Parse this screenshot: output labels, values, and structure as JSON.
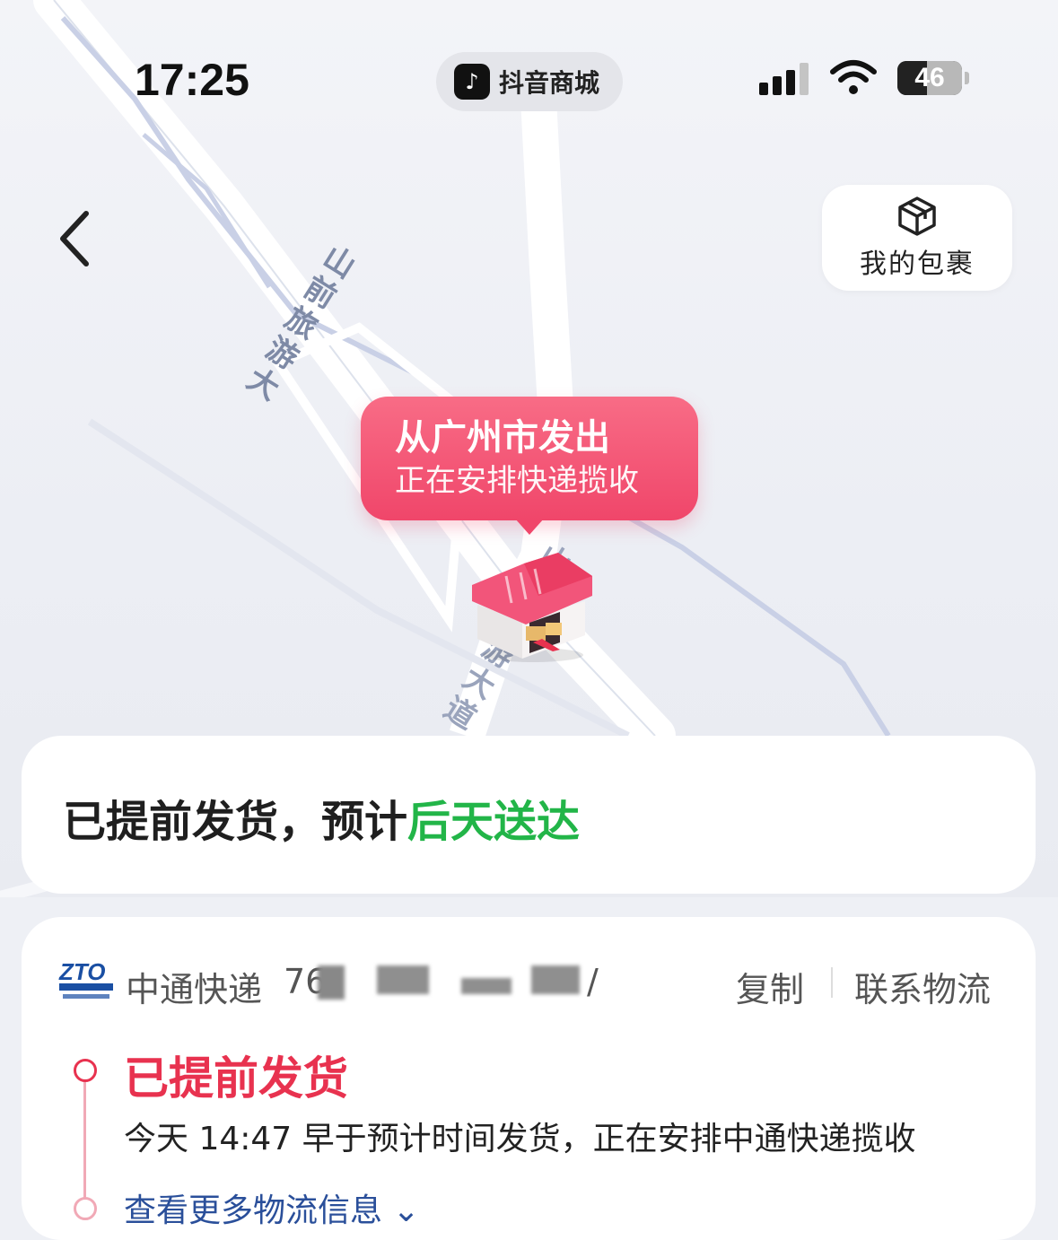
{
  "status_bar": {
    "time": "17:25",
    "app_name": "抖音商城",
    "battery_level": "46",
    "battery_fraction": 0.46
  },
  "map": {
    "road_label_upper": "山前旅游大",
    "road_label_lower": "山前旅游大道"
  },
  "header": {
    "parcel_label": "我的包裹"
  },
  "bubble": {
    "title": "从广州市发出",
    "subtitle": "正在安排快递揽收"
  },
  "eta": {
    "prefix": "已提前发货，预计",
    "highlight": "后天送达",
    "highlight_color": "#22b548"
  },
  "tracking": {
    "carrier_name": "中通快递",
    "tracking_number_visible": "76",
    "tracking_number_end": "/",
    "copy_label": "复制",
    "contact_label": "联系物流",
    "status_title": "已提前发货",
    "status_color": "#e8324f",
    "status_detail": "今天 14:47  早于预计时间发货，正在安排中通快递揽收",
    "more_link": "查看更多物流信息"
  },
  "icons": [
    "back-chevron-icon",
    "parcel-box-icon",
    "warehouse-icon",
    "zto-logo-icon",
    "signal-icon",
    "wifi-icon",
    "battery-icon",
    "chevron-down-icon"
  ]
}
